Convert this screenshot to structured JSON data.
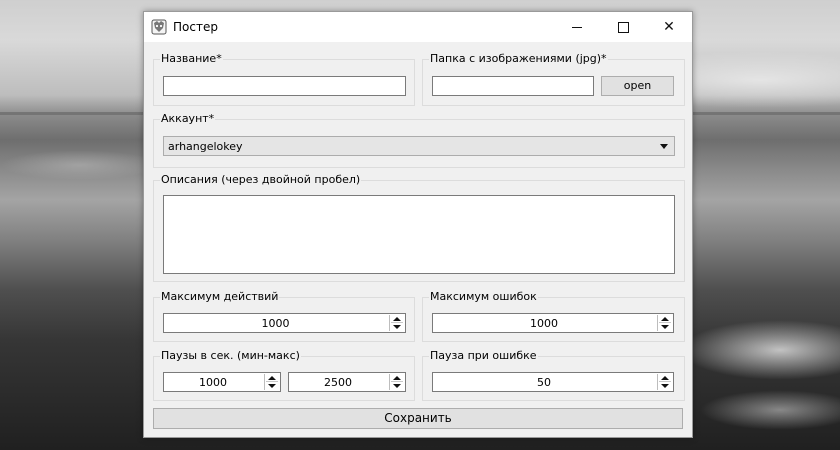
{
  "window": {
    "title": "Постер",
    "icon": "app-icon"
  },
  "titlebar_buttons": {
    "minimize": "minimize-icon",
    "maximize": "maximize-icon",
    "close": "close-icon",
    "close_glyph": "✕"
  },
  "name_group": {
    "label": "Название*",
    "value": ""
  },
  "folder_group": {
    "label": "Папка с изображениями (jpg)*",
    "value": "",
    "open_label": "open"
  },
  "account_group": {
    "label": "Аккаунт*",
    "selected": "arhangelokey"
  },
  "descriptions_group": {
    "label": "Описания (через двойной пробел)",
    "value": ""
  },
  "max_actions_group": {
    "label": "Максимум действий",
    "value": "1000"
  },
  "max_errors_group": {
    "label": "Максимум ошибок",
    "value": "1000"
  },
  "pauses_group": {
    "label": "Паузы в сек. (мин-макс)",
    "min_value": "1000",
    "max_value": "2500"
  },
  "error_pause_group": {
    "label": "Пауза при ошибке",
    "value": "50"
  },
  "save_button": {
    "label": "Сохранить"
  }
}
